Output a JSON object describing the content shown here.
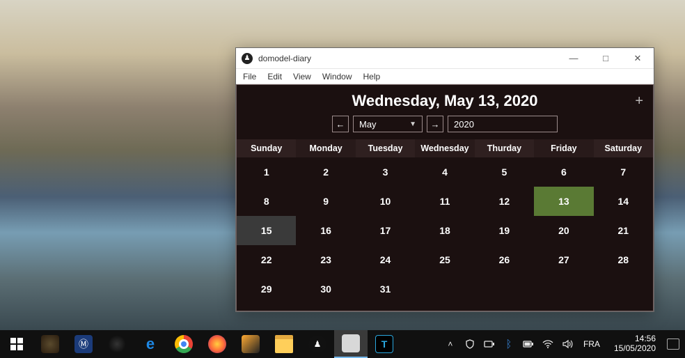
{
  "window": {
    "title": "domodel-diary",
    "menus": [
      "File",
      "Edit",
      "View",
      "Window",
      "Help"
    ],
    "controls": {
      "minimize": "—",
      "maximize": "□",
      "close": "✕"
    }
  },
  "calendar": {
    "date_header": "Wednesday, May 13, 2020",
    "month": "May",
    "year": "2020",
    "add_label": "+",
    "dow": [
      "Sunday",
      "Monday",
      "Tuesday",
      "Wednesday",
      "Thurday",
      "Friday",
      "Saturday"
    ],
    "days": [
      "1",
      "2",
      "3",
      "4",
      "5",
      "6",
      "7",
      "8",
      "9",
      "10",
      "11",
      "12",
      "13",
      "14",
      "15",
      "16",
      "17",
      "18",
      "19",
      "20",
      "21",
      "22",
      "23",
      "24",
      "25",
      "26",
      "27",
      "28",
      "29",
      "30",
      "31",
      "",
      "",
      "",
      ""
    ],
    "today": "13",
    "hover": "15"
  },
  "taskbar": {
    "language": "FRA",
    "time": "14:56",
    "date": "15/05/2020"
  }
}
